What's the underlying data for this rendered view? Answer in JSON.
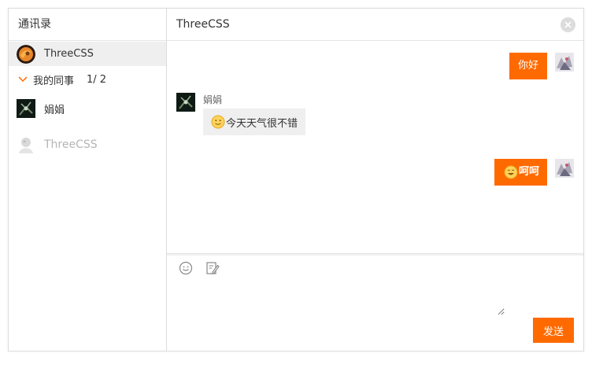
{
  "sidebar": {
    "title": "通讯录",
    "contacts": [
      {
        "name": "ThreeCSS",
        "status": "online",
        "active": true
      },
      {
        "name": "娟娟",
        "status": "online"
      },
      {
        "name": "ThreeCSS",
        "status": "offline"
      }
    ],
    "group": {
      "label": "我的同事",
      "count": "1/ 2",
      "expanded": true
    }
  },
  "chat": {
    "title": "ThreeCSS",
    "messages": [
      {
        "side": "right",
        "text": "你好"
      },
      {
        "side": "left",
        "sender": "娟娟",
        "text": "今天天气很不错",
        "emoji": "smile-emoji"
      },
      {
        "side": "right",
        "text": "呵呵",
        "emoji": "grin-emoji",
        "bold": true
      }
    ],
    "toolbar": {
      "icons": [
        "smiley-icon",
        "edit-icon"
      ]
    },
    "input": {
      "value": "",
      "placeholder": ""
    },
    "send_label": "发送"
  },
  "colors": {
    "accent": "#ff6a00",
    "bubble_gray": "#efefef",
    "border": "#dcdcdc",
    "active_bg": "#efefef",
    "muted_text": "#b5b5b5"
  }
}
